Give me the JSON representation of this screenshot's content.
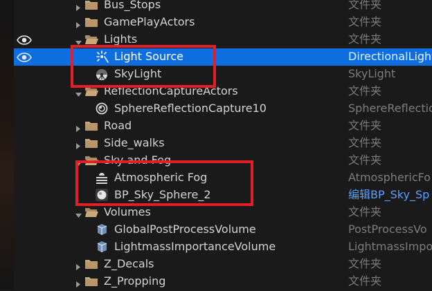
{
  "rows": [
    {
      "label": "Bus_Stops",
      "type": "文件夹",
      "kind": "folder",
      "expanded": false,
      "selected": false,
      "visible_eye": false,
      "icon": "folder-icon"
    },
    {
      "label": "GamePlayActors",
      "type": "文件夹",
      "kind": "folder",
      "expanded": false,
      "selected": false,
      "visible_eye": false,
      "icon": "folder-icon"
    },
    {
      "label": "Lights",
      "type": "文件夹",
      "kind": "folder",
      "expanded": true,
      "selected": false,
      "visible_eye": true,
      "icon": "folder-open-icon"
    },
    {
      "label": "Light Source",
      "type": "DirectionalLight",
      "kind": "actor",
      "selected": true,
      "visible_eye": true,
      "icon": "directional-light-icon"
    },
    {
      "label": "SkyLight",
      "type": "SkyLight",
      "kind": "actor",
      "selected": false,
      "visible_eye": false,
      "icon": "sky-light-icon"
    },
    {
      "label": "ReflectionCaptureActors",
      "type": "文件夹",
      "kind": "folder",
      "expanded": true,
      "selected": false,
      "visible_eye": false,
      "icon": "folder-open-icon"
    },
    {
      "label": "SphereReflectionCapture10",
      "type": "SphereReflectio",
      "kind": "actor",
      "selected": false,
      "visible_eye": false,
      "icon": "sphere-reflection-capture-icon"
    },
    {
      "label": "Road",
      "type": "文件夹",
      "kind": "folder",
      "expanded": false,
      "selected": false,
      "visible_eye": false,
      "icon": "folder-icon"
    },
    {
      "label": "Side_walks",
      "type": "文件夹",
      "kind": "folder",
      "expanded": false,
      "selected": false,
      "visible_eye": false,
      "icon": "folder-icon"
    },
    {
      "label": "Sky and Fog",
      "type": "文件夹",
      "kind": "folder",
      "expanded": true,
      "selected": false,
      "visible_eye": false,
      "icon": "folder-open-icon"
    },
    {
      "label": "Atmospheric Fog",
      "type": "AtmosphericFo",
      "kind": "actor",
      "selected": false,
      "visible_eye": false,
      "icon": "atmospheric-fog-icon"
    },
    {
      "label": "BP_Sky_Sphere_2",
      "type": "编辑BP_Sky_Sp",
      "type_is_link": true,
      "kind": "actor",
      "selected": false,
      "visible_eye": false,
      "icon": "sky-sphere-icon"
    },
    {
      "label": "Volumes",
      "type": "文件夹",
      "kind": "folder",
      "expanded": true,
      "selected": false,
      "visible_eye": false,
      "icon": "folder-open-icon"
    },
    {
      "label": "GlobalPostProcessVolume",
      "type": "PostProcessVo",
      "kind": "actor",
      "selected": false,
      "visible_eye": false,
      "icon": "volume-icon"
    },
    {
      "label": "LightmassImportanceVolume",
      "type": "LightmassImpo",
      "kind": "actor",
      "selected": false,
      "visible_eye": false,
      "icon": "volume-icon"
    },
    {
      "label": "Z_Decals",
      "type": "文件夹",
      "kind": "folder",
      "expanded": false,
      "selected": false,
      "visible_eye": false,
      "icon": "folder-icon"
    },
    {
      "label": "Z_Propping",
      "type": "文件夹",
      "kind": "folder",
      "expanded": false,
      "selected": false,
      "visible_eye": false,
      "icon": "folder-icon"
    }
  ],
  "colors": {
    "selection": "#0e6ee0",
    "highlight_box": "#e21f26",
    "folder": "#c8a878",
    "link_text": "#5aa0ff",
    "background": "#1a1a1a"
  }
}
